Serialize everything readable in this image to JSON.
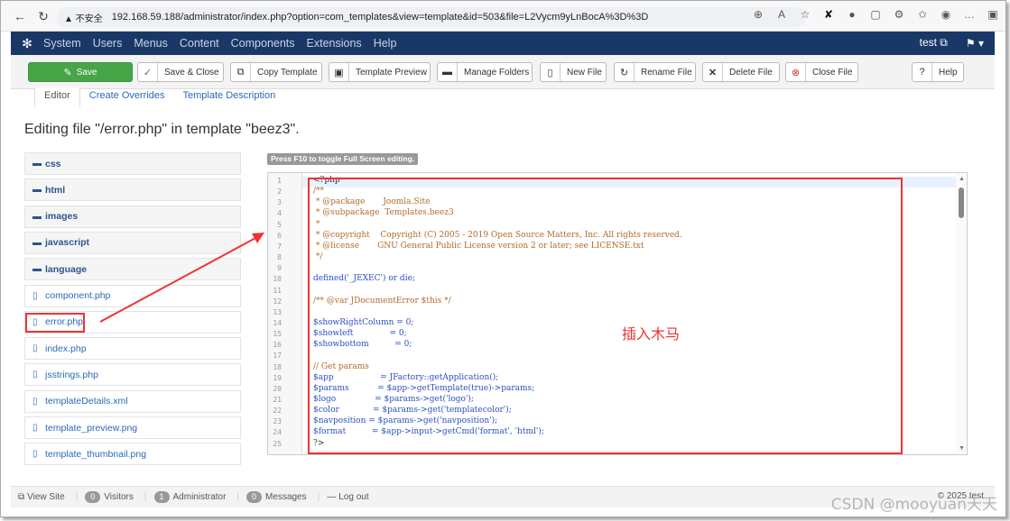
{
  "browser": {
    "warning": "▲ 不安全",
    "url": "192.168.59.188/administrator/index.php?option=com_templates&view=template&id=503&file=L2Vycm9yLnBocA%3D%3D"
  },
  "nav": {
    "items": [
      "System",
      "Users",
      "Menus",
      "Content",
      "Components",
      "Extensions",
      "Help"
    ],
    "user": "test ⧉",
    "profile": "⚑ ▾"
  },
  "toolbar": {
    "save": "Save",
    "save_close": "Save & Close",
    "copy_template": "Copy Template",
    "template_preview": "Template Preview",
    "manage_folders": "Manage Folders",
    "new_file": "New File",
    "rename_file": "Rename File",
    "delete_file": "Delete File",
    "close_file": "Close File",
    "help": "Help"
  },
  "tabs": [
    "Editor",
    "Create Overrides",
    "Template Description"
  ],
  "title": "Editing file \"/error.php\" in template \"beez3\".",
  "files": [
    {
      "name": "css",
      "type": "folder"
    },
    {
      "name": "html",
      "type": "folder"
    },
    {
      "name": "images",
      "type": "folder"
    },
    {
      "name": "javascript",
      "type": "folder"
    },
    {
      "name": "language",
      "type": "folder"
    },
    {
      "name": "component.php",
      "type": "file"
    },
    {
      "name": "error.php",
      "type": "file"
    },
    {
      "name": "index.php",
      "type": "file"
    },
    {
      "name": "jsstrings.php",
      "type": "file"
    },
    {
      "name": "templateDetails.xml",
      "type": "file"
    },
    {
      "name": "template_preview.png",
      "type": "file"
    },
    {
      "name": "template_thumbnail.png",
      "type": "file"
    }
  ],
  "editor": {
    "hint": "Press F10 to toggle Full Screen editing.",
    "lines": [
      {
        "n": "1",
        "text": "<?php",
        "style": "plain"
      },
      {
        "n": "2",
        "text": "/**",
        "style": "comment"
      },
      {
        "n": "3",
        "text": " * @package       Joomla.Site",
        "style": "comment"
      },
      {
        "n": "4",
        "text": " * @subpackage  Templates.beez3",
        "style": "comment"
      },
      {
        "n": "5",
        "text": " *",
        "style": "comment"
      },
      {
        "n": "6",
        "text": " * @copyright    Copyright (C) 2005 - 2019 Open Source Matters, Inc. All rights reserved.",
        "style": "comment"
      },
      {
        "n": "7",
        "text": " * @license       GNU General Public License version 2 or later; see LICENSE.txt",
        "style": "comment"
      },
      {
        "n": "8",
        "text": " */",
        "style": "comment"
      },
      {
        "n": "9",
        "text": "",
        "style": "plain"
      },
      {
        "n": "10",
        "text": "defined('_JEXEC') or die;",
        "style": "code"
      },
      {
        "n": "11",
        "text": "",
        "style": "plain"
      },
      {
        "n": "12",
        "text": "/** @var JDocumentError $this */",
        "style": "comment"
      },
      {
        "n": "13",
        "text": "",
        "style": "plain"
      },
      {
        "n": "14",
        "text": "$showRightColumn = 0;",
        "style": "code"
      },
      {
        "n": "15",
        "text": "$showleft              = 0;",
        "style": "code"
      },
      {
        "n": "16",
        "text": "$showbottom          = 0;",
        "style": "code"
      },
      {
        "n": "17",
        "text": "",
        "style": "plain"
      },
      {
        "n": "18",
        "text": "// Get params",
        "style": "comment"
      },
      {
        "n": "19",
        "text": "$app                  = JFactory::getApplication();",
        "style": "code"
      },
      {
        "n": "20",
        "text": "$params           = $app->getTemplate(true)->params;",
        "style": "code"
      },
      {
        "n": "21",
        "text": "$logo               = $params->get('logo');",
        "style": "code"
      },
      {
        "n": "22",
        "text": "$color             = $params->get('templatecolor');",
        "style": "code"
      },
      {
        "n": "23",
        "text": "$navposition = $params->get('navposition');",
        "style": "code"
      },
      {
        "n": "24",
        "text": "$format          = $app->input->getCmd('format', 'html');",
        "style": "code"
      },
      {
        "n": "25",
        "text": "?>",
        "style": "plain"
      }
    ]
  },
  "annotation": "插入木马",
  "status": {
    "view_site": "View Site",
    "visitors_count": "0",
    "visitors": "Visitors",
    "admin_count": "1",
    "admin": "Administrator",
    "messages_count": "0",
    "messages": "Messages",
    "logout": "Log out",
    "copyright": "© 2025 test"
  },
  "watermark": "CSDN @mooyuan天天"
}
